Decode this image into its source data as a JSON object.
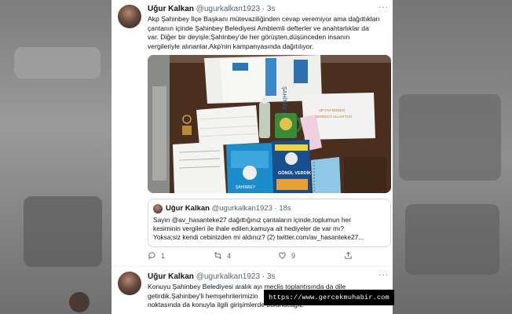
{
  "tweet1": {
    "name": "Uğur Kalkan",
    "handle": "@ugurkalkan1923",
    "time": "· 3s",
    "more": "···",
    "body_lines": [
      "Akp Şahinbey İlçe Başkanı mütevaziliğinden cevap veremiyor ama dağıttıkları",
      "çantanın içinde Şahinbey Belediyesi Amblemli defterler ve anahtarlıklar da",
      "var. Diğer bir deyişle;Şahinbey'de her görüşten,düşünceden insanın",
      "vergileriyle alınanlar,Akp'nin kampanyasında dağıtılıyor."
    ],
    "photo": {
      "book_title_1": "ŞAHİNBEY",
      "book_title_2": "GÖNÜL VERDİK",
      "card_text_1": "SİFTAH BİZDEN",
      "card_text_2": "BEREKET ALLAH'TAN",
      "bag_text": "ŞAHİNBEY'LE"
    },
    "quote": {
      "name": "Uğur Kalkan",
      "handle": "@ugurkalkan1923",
      "time": "· 18s",
      "lines": [
        "Sayın @av_hasanteke27 dağıttığınız çantaların içinde,toplumun her",
        "kesiminin vergileri ile ihale edilen,kamuya ait hediyeler de var mı?",
        "Yoksa;siz kendi cebinizden mi aldınız? (2) twitter.com/av_hasanteke27..."
      ]
    },
    "actions": {
      "reply_count": "1",
      "retweet_count": "4",
      "like_count": "9"
    }
  },
  "tweet2": {
    "name": "Uğur Kalkan",
    "handle": "@ugurkalkan1923",
    "time": "· 3s",
    "more": "···",
    "body_lines": [
      "Konuyu Şahinbey Belediyesi aralık ayı meclis toplantısında da dile",
      "getirdik.Şahinbey'li hemşehrilerimizin",
      "noktasında da konuyla ilgili girişimlerde bulunacağız."
    ]
  },
  "watermark": "https://www.gercekmuhabir.com",
  "colors": {
    "text": "#0f1419",
    "muted": "#536471",
    "like_red": "#f91880",
    "border": "#cfd9de"
  }
}
